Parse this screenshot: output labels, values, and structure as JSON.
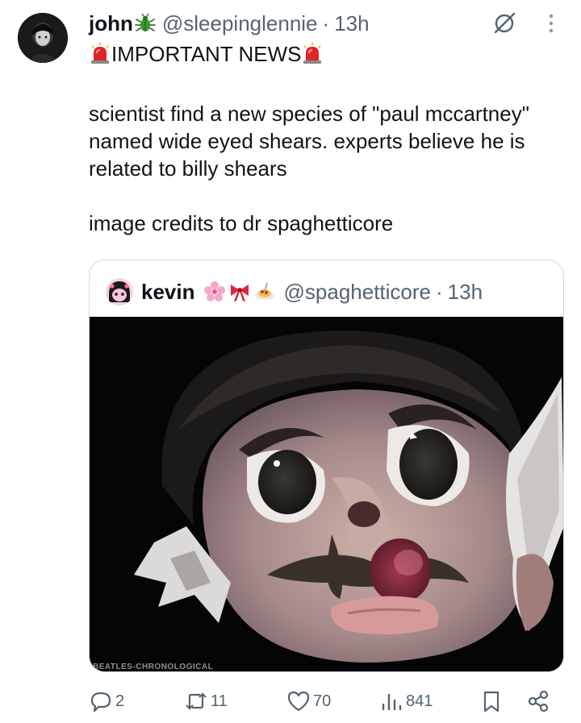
{
  "author": {
    "name": "john",
    "badge": "beetle-emoji",
    "handle": "@sleepinglennie",
    "separator": "·",
    "time": "13h"
  },
  "headline": {
    "siren": "police-light-emoji",
    "text": "IMPORTANT NEWS"
  },
  "body": {
    "paragraph1": "scientist find a new species of \"paul mccartney\" named wide eyed shears. experts believe he is related to billy shears",
    "paragraph2": "image credits to dr spaghetticore"
  },
  "quote": {
    "name": "kevin",
    "emojis": [
      "cherry-blossom-emoji",
      "ribbon-emoji",
      "spaghetti-emoji"
    ],
    "handle": "@spaghetticore",
    "separator": "·",
    "time": "13h",
    "watermark": "BEATLES-CHRONOLOGICAL"
  },
  "actions": {
    "replies": "2",
    "reposts": "11",
    "likes": "70",
    "views": "841"
  },
  "colors": {
    "text": "#0f1419",
    "secondary": "#536471",
    "border": "#cfd9de",
    "beetle": "#3a9a2e",
    "siren": "#e0242b"
  }
}
